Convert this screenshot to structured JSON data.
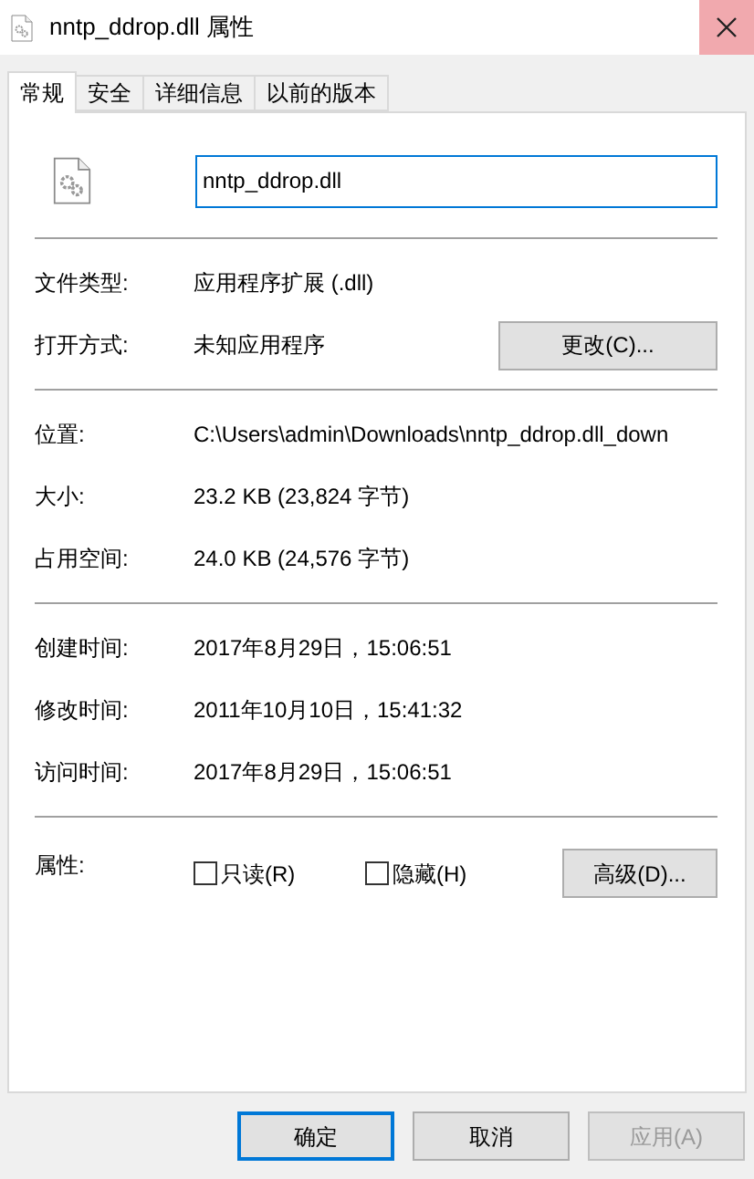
{
  "window": {
    "title": "nntp_ddrop.dll 属性"
  },
  "tabs": [
    {
      "label": "常规",
      "selected": true
    },
    {
      "label": "安全",
      "selected": false
    },
    {
      "label": "详细信息",
      "selected": false
    },
    {
      "label": "以前的版本",
      "selected": false
    }
  ],
  "file_name": "nntp_ddrop.dll",
  "sections": [
    {
      "rows": [
        {
          "label": "文件类型:",
          "value": "应用程序扩展 (.dll)"
        },
        {
          "label": "打开方式:",
          "value": "未知应用程序",
          "button": "更改(C)..."
        }
      ]
    },
    {
      "rows": [
        {
          "label": "位置:",
          "value": "C:\\Users\\admin\\Downloads\\nntp_ddrop.dll_down"
        },
        {
          "label": "大小:",
          "value": "23.2 KB (23,824 字节)"
        },
        {
          "label": "占用空间:",
          "value": "24.0 KB (24,576 字节)"
        }
      ]
    },
    {
      "rows": [
        {
          "label": "创建时间:",
          "value": "2017年8月29日，15:06:51"
        },
        {
          "label": "修改时间:",
          "value": "2011年10月10日，15:41:32"
        },
        {
          "label": "访问时间:",
          "value": "2017年8月29日，15:06:51"
        }
      ]
    }
  ],
  "attributes": {
    "label": "属性:",
    "checkboxes": [
      {
        "label": "只读(R)",
        "checked": false
      },
      {
        "label": "隐藏(H)",
        "checked": false
      }
    ],
    "button": "高级(D)..."
  },
  "buttons": [
    {
      "label": "确定",
      "default": true,
      "disabled": false
    },
    {
      "label": "取消",
      "default": false,
      "disabled": false
    },
    {
      "label": "应用(A)",
      "default": false,
      "disabled": true
    }
  ]
}
